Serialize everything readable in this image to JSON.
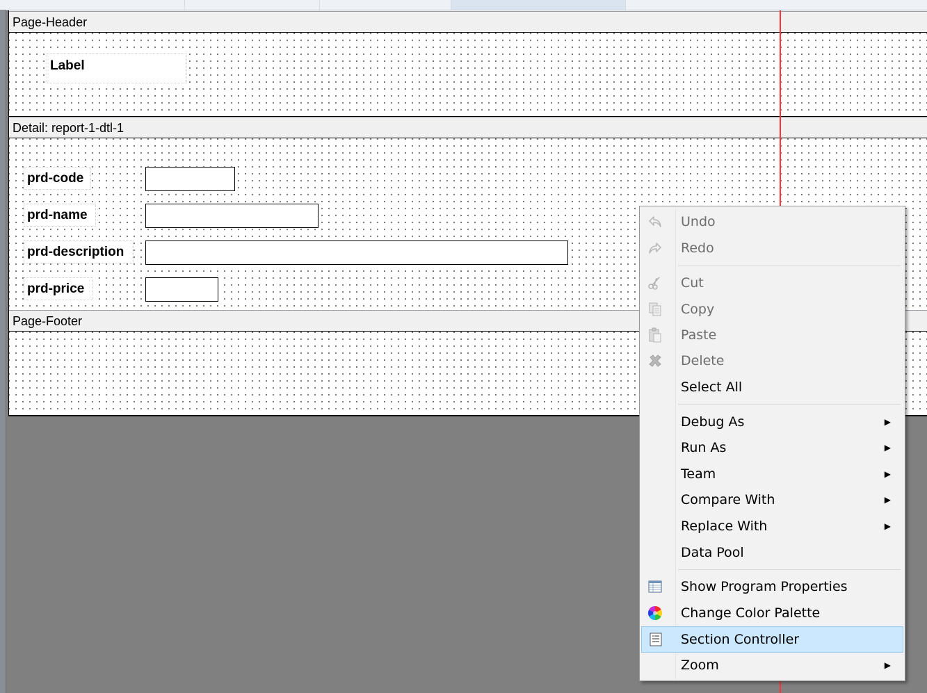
{
  "report": {
    "sections": [
      {
        "title": "Page-Header"
      },
      {
        "title": "Detail: report-1-dtl-1"
      },
      {
        "title": "Page-Footer"
      }
    ],
    "header_label": "Label",
    "detail_fields": [
      {
        "label": "prd-code"
      },
      {
        "label": "prd-name"
      },
      {
        "label": "prd-description"
      },
      {
        "label": "prd-price"
      }
    ]
  },
  "context_menu": {
    "items": [
      {
        "label": "Undo",
        "icon": "undo-icon",
        "disabled": true
      },
      {
        "label": "Redo",
        "icon": "redo-icon",
        "disabled": true
      },
      {
        "label": "Cut",
        "icon": "cut-icon",
        "disabled": true
      },
      {
        "label": "Copy",
        "icon": "copy-icon",
        "disabled": true
      },
      {
        "label": "Paste",
        "icon": "paste-icon",
        "disabled": true
      },
      {
        "label": "Delete",
        "icon": "delete-icon",
        "disabled": true
      },
      {
        "label": "Select All"
      },
      {
        "label": "Debug As",
        "submenu": true
      },
      {
        "label": "Run As",
        "submenu": true
      },
      {
        "label": "Team",
        "submenu": true
      },
      {
        "label": "Compare With",
        "submenu": true
      },
      {
        "label": "Replace With",
        "submenu": true
      },
      {
        "label": "Data Pool"
      },
      {
        "label": "Show Program Properties",
        "icon": "properties-table-icon"
      },
      {
        "label": "Change Color Palette",
        "icon": "color-wheel-icon"
      },
      {
        "label": "Section Controller",
        "icon": "section-controller-icon",
        "selected": true
      },
      {
        "label": "Zoom",
        "submenu": true
      }
    ],
    "submenu_arrow": "▶"
  },
  "colors": {
    "workspace_bg": "#808080",
    "guide_line": "#ff3333",
    "menu_selected": "#cce8ff"
  }
}
